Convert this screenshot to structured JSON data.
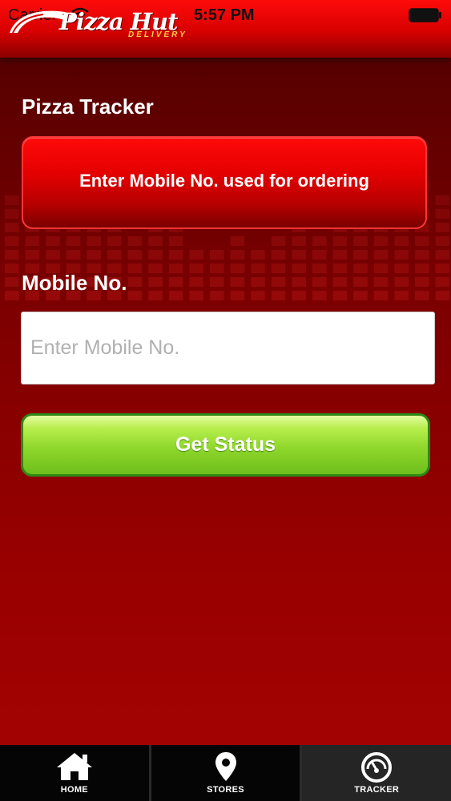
{
  "status_bar": {
    "carrier": "Carrier",
    "time": "5:57 PM"
  },
  "brand": {
    "name": "Pizza Hut",
    "tagline": "DELIVERY",
    "primary_color": "#e00000",
    "accent_color": "#ffd24a"
  },
  "page": {
    "title": "Pizza Tracker",
    "info_message": "Enter Mobile No. used for ordering"
  },
  "form": {
    "mobile_label": "Mobile No.",
    "mobile_value": "",
    "mobile_placeholder": "Enter Mobile No.",
    "submit_label": "Get Status",
    "submit_color": "#8fd72b"
  },
  "tabs": [
    {
      "label": "HOME",
      "icon": "home-icon",
      "active": false
    },
    {
      "label": "STORES",
      "icon": "map-pin-icon",
      "active": false
    },
    {
      "label": "TRACKER",
      "icon": "speedometer-icon",
      "active": true
    }
  ]
}
